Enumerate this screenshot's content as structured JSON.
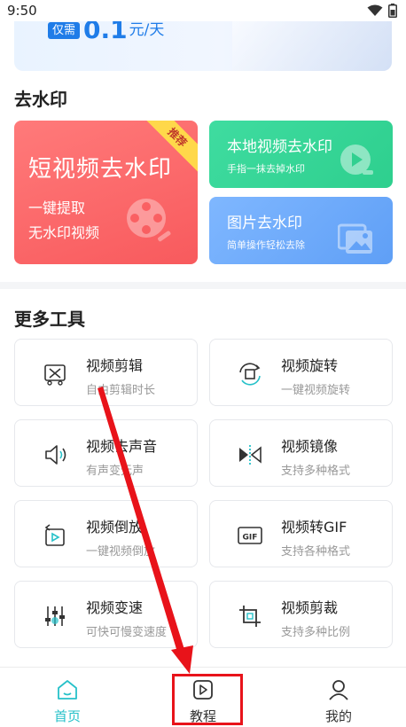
{
  "status_bar": {
    "time": "9:50",
    "wifi_icon": "wifi-icon",
    "battery_icon": "battery-icon"
  },
  "banner": {
    "tag": "仅需",
    "price": "0.1",
    "unit": "元/天"
  },
  "section_watermark": {
    "title": "去水印",
    "big_card": {
      "title": "短视频去水印",
      "line1": "一键提取",
      "line2": "无水印视频",
      "badge": "推荐"
    },
    "local_card": {
      "title": "本地视频去水印",
      "subtitle": "手指一抹去掉水印"
    },
    "image_card": {
      "title": "图片去水印",
      "subtitle": "简单操作轻松去除"
    }
  },
  "section_tools": {
    "title": "更多工具",
    "tools": [
      {
        "name": "视频剪辑",
        "desc": "自由剪辑时长",
        "icon": "video-cut-icon"
      },
      {
        "name": "视频旋转",
        "desc": "一键视频旋转",
        "icon": "rotate-icon"
      },
      {
        "name": "视频去声音",
        "desc": "有声变无声",
        "icon": "mute-icon"
      },
      {
        "name": "视频镜像",
        "desc": "支持多种格式",
        "icon": "mirror-icon"
      },
      {
        "name": "视频倒放",
        "desc": "一键视频倒放",
        "icon": "reverse-icon"
      },
      {
        "name": "视频转GIF",
        "desc": "支持各种格式",
        "icon": "gif-icon"
      },
      {
        "name": "视频变速",
        "desc": "可快可慢变速度",
        "icon": "speed-icon"
      },
      {
        "name": "视频剪裁",
        "desc": "支持多种比例",
        "icon": "crop-icon"
      }
    ]
  },
  "tabbar": {
    "tabs": [
      {
        "label": "首页",
        "icon": "home-icon",
        "active": true
      },
      {
        "label": "教程",
        "icon": "play-icon",
        "active": false
      },
      {
        "label": "我的",
        "icon": "user-icon",
        "active": false
      }
    ]
  },
  "colors": {
    "accent": "#26c1c9",
    "red_card": "#f85a5d",
    "green_card": "#2ecf8e",
    "blue_card": "#5f9ff6",
    "annotation": "#e8131a"
  }
}
